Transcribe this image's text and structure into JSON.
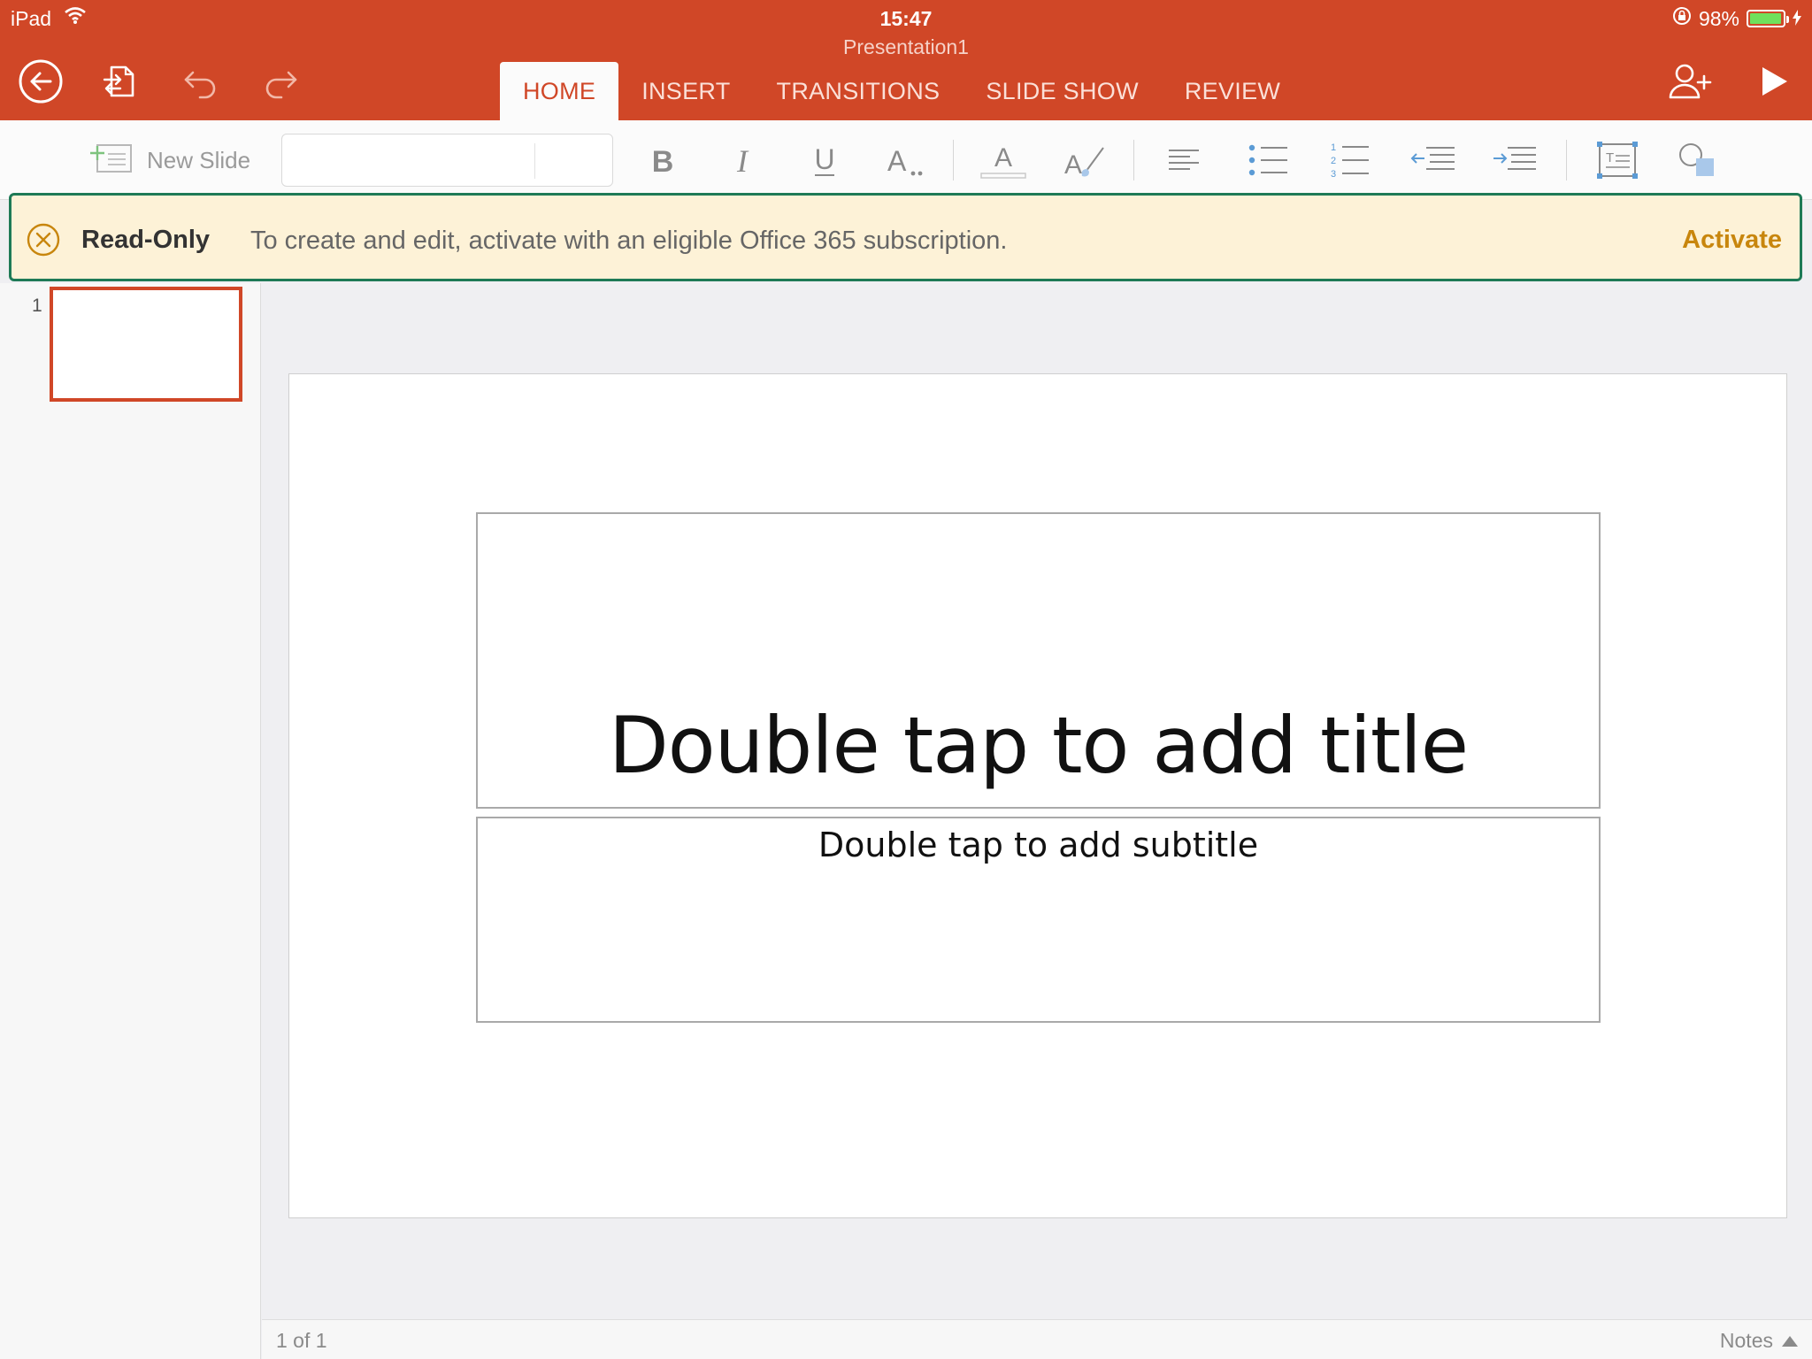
{
  "status_bar": {
    "carrier": "iPad",
    "time": "15:47",
    "battery": "98%",
    "battery_level": 0.98
  },
  "document": {
    "title": "Presentation1"
  },
  "header": {
    "tabs": [
      {
        "label": "HOME",
        "active": true
      },
      {
        "label": "INSERT",
        "active": false
      },
      {
        "label": "TRANSITIONS",
        "active": false
      },
      {
        "label": "SLIDE SHOW",
        "active": false
      },
      {
        "label": "REVIEW",
        "active": false
      }
    ],
    "icons": [
      "back-icon",
      "file-icon",
      "undo-icon",
      "redo-icon",
      "share-person-icon",
      "play-icon"
    ]
  },
  "ribbon": {
    "new_slide_label": "New Slide",
    "font_name": "",
    "font_size": "",
    "icons": [
      "bold-icon",
      "italic-icon",
      "underline-icon",
      "font-size-icon",
      "font-color-icon",
      "highlight-icon",
      "align-left-icon",
      "bullets-icon",
      "numbering-icon",
      "decrease-indent-icon",
      "increase-indent-icon",
      "text-box-icon",
      "shapes-icon"
    ]
  },
  "banner": {
    "label": "Read-Only",
    "message": "To create and edit, activate with an eligible Office 365 subscription.",
    "action": "Activate"
  },
  "thumbnails": [
    {
      "number": "1",
      "selected": true
    }
  ],
  "slide": {
    "title_placeholder": "Double tap to add title",
    "subtitle_placeholder": "Double tap to add subtitle"
  },
  "footer": {
    "page_indicator": "1 of 1",
    "notes_label": "Notes"
  },
  "colors": {
    "accent": "#d04727",
    "banner_bg": "#fdf2d7",
    "banner_border": "#1e7a56",
    "activate": "#c8860d"
  }
}
